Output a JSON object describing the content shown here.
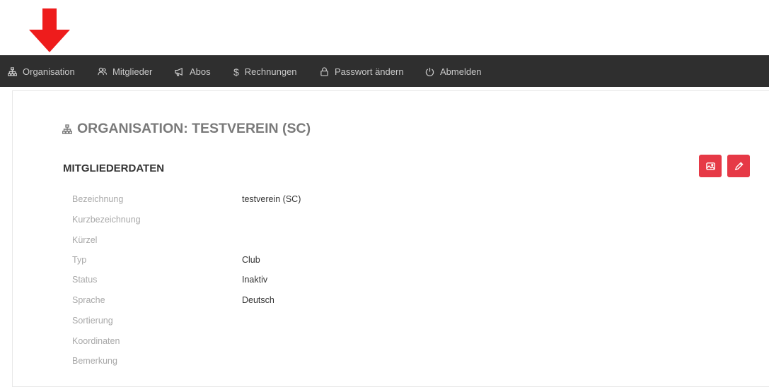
{
  "nav": {
    "items": [
      {
        "label": "Organisation",
        "icon": "sitemap-icon"
      },
      {
        "label": "Mitglieder",
        "icon": "users-icon"
      },
      {
        "label": "Abos",
        "icon": "megaphone-icon"
      },
      {
        "label": "Rechnungen",
        "icon": "dollar-icon"
      },
      {
        "label": "Passwort ändern",
        "icon": "lock-icon"
      },
      {
        "label": "Abmelden",
        "icon": "power-icon"
      }
    ]
  },
  "page": {
    "title": "ORGANISATION: TESTVEREIN (SC)",
    "section_title": "MITGLIEDERDATEN"
  },
  "actions": {
    "image_icon": "image-icon",
    "edit_icon": "pencil-icon"
  },
  "fields": [
    {
      "label": "Bezeichnung",
      "value": "testverein (SC)"
    },
    {
      "label": "Kurzbezeichnung",
      "value": ""
    },
    {
      "label": "Kürzel",
      "value": ""
    },
    {
      "label": "Typ",
      "value": "Club"
    },
    {
      "label": "Status",
      "value": "Inaktiv"
    },
    {
      "label": "Sprache",
      "value": "Deutsch"
    },
    {
      "label": "Sortierung",
      "value": ""
    },
    {
      "label": "Koordinaten",
      "value": ""
    },
    {
      "label": "Bemerkung",
      "value": ""
    }
  ],
  "colors": {
    "navbar": "#2f2f2f",
    "accent": "#e63946",
    "arrow": "#ee1c1c"
  }
}
